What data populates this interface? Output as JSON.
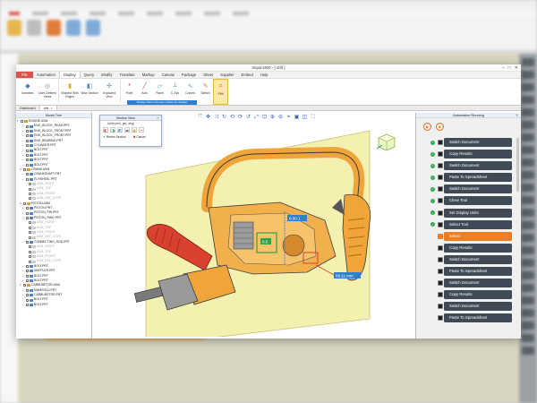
{
  "window": {
    "title": "Impact360 - [ drill ]",
    "controls": [
      "–",
      "□",
      "✕"
    ]
  },
  "menubar": {
    "items": [
      "File",
      "Automation",
      "Display",
      "Query",
      "Modify",
      "Translate",
      "Markup",
      "Canvas",
      "Package",
      "Sheet",
      "Supplier",
      "Embed",
      "Help"
    ],
    "active": "Display"
  },
  "ribbon": {
    "buttons": [
      {
        "name": "isometric",
        "label": "Isometric",
        "icon": "cube-icon",
        "color": "#3b78c9"
      },
      {
        "name": "user-defined",
        "label": "User-Defined Views",
        "icon": "camera-icon",
        "color": "#8a8a8a"
      },
      {
        "name": "shaded-with-edges",
        "label": "Shaded With Edges",
        "icon": "shaded-cylinder-icon",
        "color": "#e0a92c"
      },
      {
        "name": "view-section",
        "label": "View Section",
        "icon": "section-icon",
        "color": "#5a8fd0"
      },
      {
        "name": "exploded-view",
        "label": "Exploded View",
        "icon": "explode-icon",
        "color": "#5a8fd0"
      },
      {
        "name": "point",
        "label": "Point",
        "icon": "point-icon",
        "color": "#d04a4a"
      },
      {
        "name": "axis",
        "label": "Axis",
        "icon": "axis-icon",
        "color": "#d04a4a"
      },
      {
        "name": "plane",
        "label": "Plane",
        "icon": "plane-icon",
        "color": "#4a9ad0"
      },
      {
        "name": "csys",
        "label": "C-Sys",
        "icon": "csys-icon",
        "color": "#4a9ad0"
      },
      {
        "name": "curves",
        "label": "Curves",
        "icon": "curve-icon",
        "color": "#4a9ad0"
      },
      {
        "name": "sketch",
        "label": "Sketch",
        "icon": "sketch-icon",
        "color": "#d08a4a"
      },
      {
        "name": "pmi",
        "label": "PMI",
        "icon": "pmi-icon",
        "color": "#d08a4a"
      }
    ],
    "filter_label": "Display Filters (Choose entities for display)"
  },
  "tabs": [
    {
      "label": "Dashboard",
      "active": false
    },
    {
      "label": "drill",
      "active": true
    }
  ],
  "tree": {
    "header": "Model Tree",
    "items": [
      {
        "label": "ENGINE.ASM",
        "asm": true,
        "faded": false
      },
      {
        "label": "ENG_BLOCK_REAR.PRT",
        "asm": false,
        "faded": false
      },
      {
        "label": "ENG_BLOCK_FRONT.PRT",
        "asm": false,
        "faded": false
      },
      {
        "label": "ENG_BLOCK_FRONT.PRT",
        "asm": false,
        "faded": false
      },
      {
        "label": "ENG_BEARING.PRT",
        "asm": false,
        "faded": false
      },
      {
        "label": "CYLINDER.PRT",
        "asm": false,
        "faded": false
      },
      {
        "label": "BOLT.PRT",
        "asm": false,
        "faded": false
      },
      {
        "label": "BOLT.PRT",
        "asm": false,
        "faded": false
      },
      {
        "label": "BOLT.PRT",
        "asm": false,
        "faded": false
      },
      {
        "label": "BOLT.PRT",
        "asm": false,
        "faded": false
      },
      {
        "label": "CRANK.ASM",
        "asm": true,
        "faded": false
      },
      {
        "label": "CRANKSHAFT.PRT",
        "asm": false,
        "faded": false
      },
      {
        "label": "FLYWHEEL.PRT",
        "asm": false,
        "faded": false
      },
      {
        "label": "ASM_RIGHT",
        "asm": false,
        "faded": true
      },
      {
        "label": "ASM_TOP",
        "asm": false,
        "faded": true
      },
      {
        "label": "ASM_FRONT",
        "asm": false,
        "faded": true
      },
      {
        "label": "ASM_DEF_CSYS",
        "asm": false,
        "faded": true
      },
      {
        "label": "PISTON.ASM",
        "asm": true,
        "faded": false
      },
      {
        "label": "PISTON.PRT",
        "asm": false,
        "faded": false
      },
      {
        "label": "PISTON_PIN.PRT",
        "asm": false,
        "faded": false
      },
      {
        "label": "PISTON_RING.PRT",
        "asm": false,
        "faded": false
      },
      {
        "label": "ASM_RIGHT",
        "asm": false,
        "faded": true
      },
      {
        "label": "ASM_TOP",
        "asm": false,
        "faded": true
      },
      {
        "label": "ASM_FRONT",
        "asm": false,
        "faded": true
      },
      {
        "label": "ASM_DEF_CSYS",
        "asm": false,
        "faded": true
      },
      {
        "label": "CONNECTING_ROD.PRT",
        "asm": false,
        "faded": false
      },
      {
        "label": "ASM_RIGHT",
        "asm": false,
        "faded": true
      },
      {
        "label": "ASM_TOP",
        "asm": false,
        "faded": true
      },
      {
        "label": "ASM_FRONT",
        "asm": false,
        "faded": true
      },
      {
        "label": "ASM_DEF_CSYS",
        "asm": false,
        "faded": true
      },
      {
        "label": "BOLT.PRT",
        "asm": false,
        "faded": false
      },
      {
        "label": "MUFFLER.PRT",
        "asm": false,
        "faded": false
      },
      {
        "label": "BOLT.PRT",
        "asm": false,
        "faded": false
      },
      {
        "label": "BOLT.PRT",
        "asm": false,
        "faded": false
      },
      {
        "label": "CARBURETOR.ASM",
        "asm": true,
        "faded": false
      },
      {
        "label": "MANIFOLD.PRT",
        "asm": false,
        "faded": false
      },
      {
        "label": "CARBURETOR.PRT",
        "asm": false,
        "faded": false
      },
      {
        "label": "BOLT.PRT",
        "asm": false,
        "faded": false
      },
      {
        "label": "BOLT.PRT",
        "asm": false,
        "faded": false
      }
    ]
  },
  "section_view": {
    "title": "Section View",
    "units": "Units (mm, gm, deg)",
    "return_label": "Return Section",
    "cancel_label": "Cancel"
  },
  "viewport": {
    "tools": [
      "⤧",
      "✥",
      "⤨",
      "↻",
      "⟲",
      "⟳",
      "↺",
      "⤢",
      "⊡",
      "⊕",
      "⊖",
      "⌖",
      "▣",
      "◫",
      "⛶"
    ],
    "dim1": "0.00 1",
    "dim2": "0.0",
    "dim3": "58.11 mm",
    "colors": {
      "plane": "#f2eda1",
      "body": "#f0a53a",
      "handle_red": "#d9412f",
      "gray": "#8c8c8c"
    }
  },
  "automation": {
    "title": "Automation Running",
    "steps": [
      {
        "label": "Switch Document",
        "done": true,
        "active": false
      },
      {
        "label": "Copy Results",
        "done": true,
        "active": false
      },
      {
        "label": "Switch Document",
        "done": true,
        "active": false
      },
      {
        "label": "Paste To Spreadsheet",
        "done": true,
        "active": false
      },
      {
        "label": "Switch Document",
        "done": true,
        "active": false
      },
      {
        "label": "Close Tool",
        "done": true,
        "active": false
      },
      {
        "label": "Set Display Units",
        "done": true,
        "active": false
      },
      {
        "label": "Select Tool",
        "done": true,
        "active": false
      },
      {
        "label": "Select",
        "done": false,
        "active": true
      },
      {
        "label": "Copy Results",
        "done": false,
        "active": false
      },
      {
        "label": "Switch Document",
        "done": false,
        "active": false
      },
      {
        "label": "Paste To Spreadsheet",
        "done": false,
        "active": false
      },
      {
        "label": "Switch Document",
        "done": false,
        "active": false
      },
      {
        "label": "Copy Results",
        "done": false,
        "active": false
      },
      {
        "label": "Switch Document",
        "done": false,
        "active": false
      },
      {
        "label": "Paste To Spreadsheet",
        "done": false,
        "active": false
      }
    ],
    "accent": "#ef7d22",
    "pill_color": "#3f4a56"
  }
}
